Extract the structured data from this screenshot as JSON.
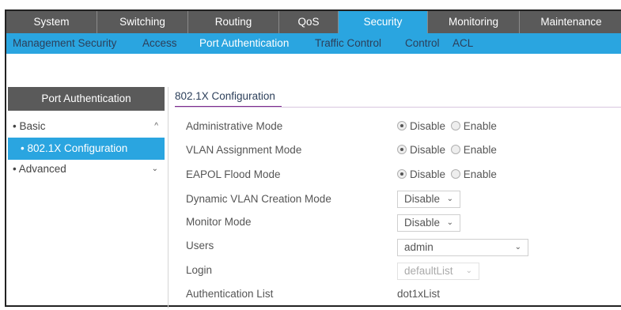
{
  "topnav": {
    "tabs": [
      {
        "label": "System"
      },
      {
        "label": "Switching"
      },
      {
        "label": "Routing"
      },
      {
        "label": "QoS"
      },
      {
        "label": "Security"
      },
      {
        "label": "Monitoring"
      },
      {
        "label": "Maintenance"
      }
    ],
    "active": "Security"
  },
  "subnav": {
    "items": [
      {
        "label": "Management Security"
      },
      {
        "label": "Access"
      },
      {
        "label": "Port Authentication"
      },
      {
        "label": "Traffic Control"
      },
      {
        "label": "Control"
      },
      {
        "label": "ACL"
      }
    ],
    "active": "Port Authentication"
  },
  "sidebar": {
    "title": "Port Authentication",
    "items": [
      {
        "label": "• Basic",
        "chevron": "^"
      },
      {
        "label": "• 802.1X Configuration"
      },
      {
        "label": "• Advanced",
        "chevron": "⌄"
      }
    ]
  },
  "main": {
    "title": "802.1X Configuration",
    "radio_options": {
      "disable": "Disable",
      "enable": "Enable"
    },
    "rows": [
      {
        "label": "Administrative Mode",
        "value": "Disable"
      },
      {
        "label": "VLAN Assignment Mode",
        "value": "Disable"
      },
      {
        "label": "EAPOL Flood Mode",
        "value": "Disable"
      },
      {
        "label": "Dynamic VLAN Creation Mode",
        "value": "Disable"
      },
      {
        "label": "Monitor Mode",
        "value": "Disable"
      },
      {
        "label": "Users",
        "value": "admin"
      },
      {
        "label": "Login",
        "value": "defaultList"
      },
      {
        "label": "Authentication List",
        "value": "dot1xList"
      }
    ]
  },
  "colors": {
    "nav_gray": "#5a5a5a",
    "accent_blue": "#2aa5e0",
    "title_underline": "#7b2b8e",
    "text_dark": "#2c3f5a"
  },
  "icons": {
    "caret": "chevron-down-icon",
    "collapse": "chevron-up-icon"
  }
}
